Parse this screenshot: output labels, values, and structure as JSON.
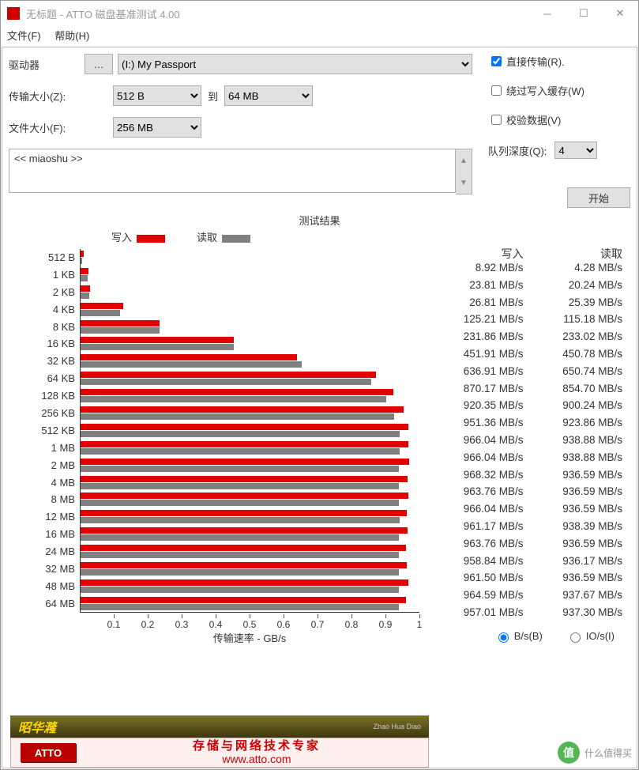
{
  "window": {
    "title": "无标题 - ATTO 磁盘基准测试 4.00"
  },
  "menu": {
    "file": "文件(F)",
    "help": "帮助(H)"
  },
  "labels": {
    "drive": "驱动器",
    "browse": "…",
    "transferSize": "传输大小(Z):",
    "to": "到",
    "fileSize": "文件大小(F):",
    "directTransfer": "直接传输(R).",
    "bypassWriteCache": "绕过写入缓存(W)",
    "verifyData": "校验数据(V)",
    "queueDepth": "队列深度(Q):",
    "start": "开始",
    "resultsTitle": "测试结果",
    "writeLegend": "写入",
    "readLegend": "读取",
    "xlabel": "传输速率 - GB/s",
    "tableWrite": "写入",
    "tableRead": "读取",
    "radioBs": "B/s(B)",
    "radioIOs": "IO/s(I)"
  },
  "dropdowns": {
    "drive": "(I:) My Passport",
    "tsFrom": "512 B",
    "tsTo": "64 MB",
    "fileSize": "256 MB",
    "queueDepth": "4"
  },
  "checkboxes": {
    "directTransfer": true,
    "bypassWriteCache": false,
    "verifyData": false
  },
  "description": "<< miaoshu >>",
  "chart_data": {
    "type": "bar",
    "title": "测试结果",
    "xlabel": "传输速率 - GB/s",
    "ylabel": "",
    "xlim": [
      0,
      1
    ],
    "xticks": [
      0.1,
      0.2,
      0.3,
      0.4,
      0.5,
      0.6,
      0.7,
      0.8,
      0.9,
      1
    ],
    "unit": "MB/s",
    "categories": [
      "512 B",
      "1 KB",
      "2 KB",
      "4 KB",
      "8 KB",
      "16 KB",
      "32 KB",
      "64 KB",
      "128 KB",
      "256 KB",
      "512 KB",
      "1 MB",
      "2 MB",
      "4 MB",
      "8 MB",
      "12 MB",
      "16 MB",
      "24 MB",
      "32 MB",
      "48 MB",
      "64 MB"
    ],
    "series": [
      {
        "name": "写入",
        "color": "#e20000",
        "values": [
          8.92,
          23.81,
          26.81,
          125.21,
          231.86,
          451.91,
          636.91,
          870.17,
          920.35,
          951.36,
          966.04,
          966.04,
          968.32,
          963.76,
          966.04,
          961.17,
          963.76,
          958.84,
          961.5,
          964.59,
          957.01
        ]
      },
      {
        "name": "读取",
        "color": "#808080",
        "values": [
          4.28,
          20.24,
          25.39,
          115.18,
          233.02,
          450.78,
          650.74,
          854.7,
          900.24,
          923.86,
          938.88,
          938.88,
          936.59,
          936.59,
          936.59,
          938.39,
          936.59,
          936.17,
          936.59,
          937.67,
          937.3
        ]
      }
    ]
  },
  "footer": {
    "brand1": "昭华漋",
    "brand1sub": "Zhao Hua Diao",
    "logo": "ATTO",
    "slogan": "存储与网络技术专家",
    "url": "www.atto.com"
  },
  "watermark": {
    "char": "值",
    "text": "什么值得买"
  }
}
